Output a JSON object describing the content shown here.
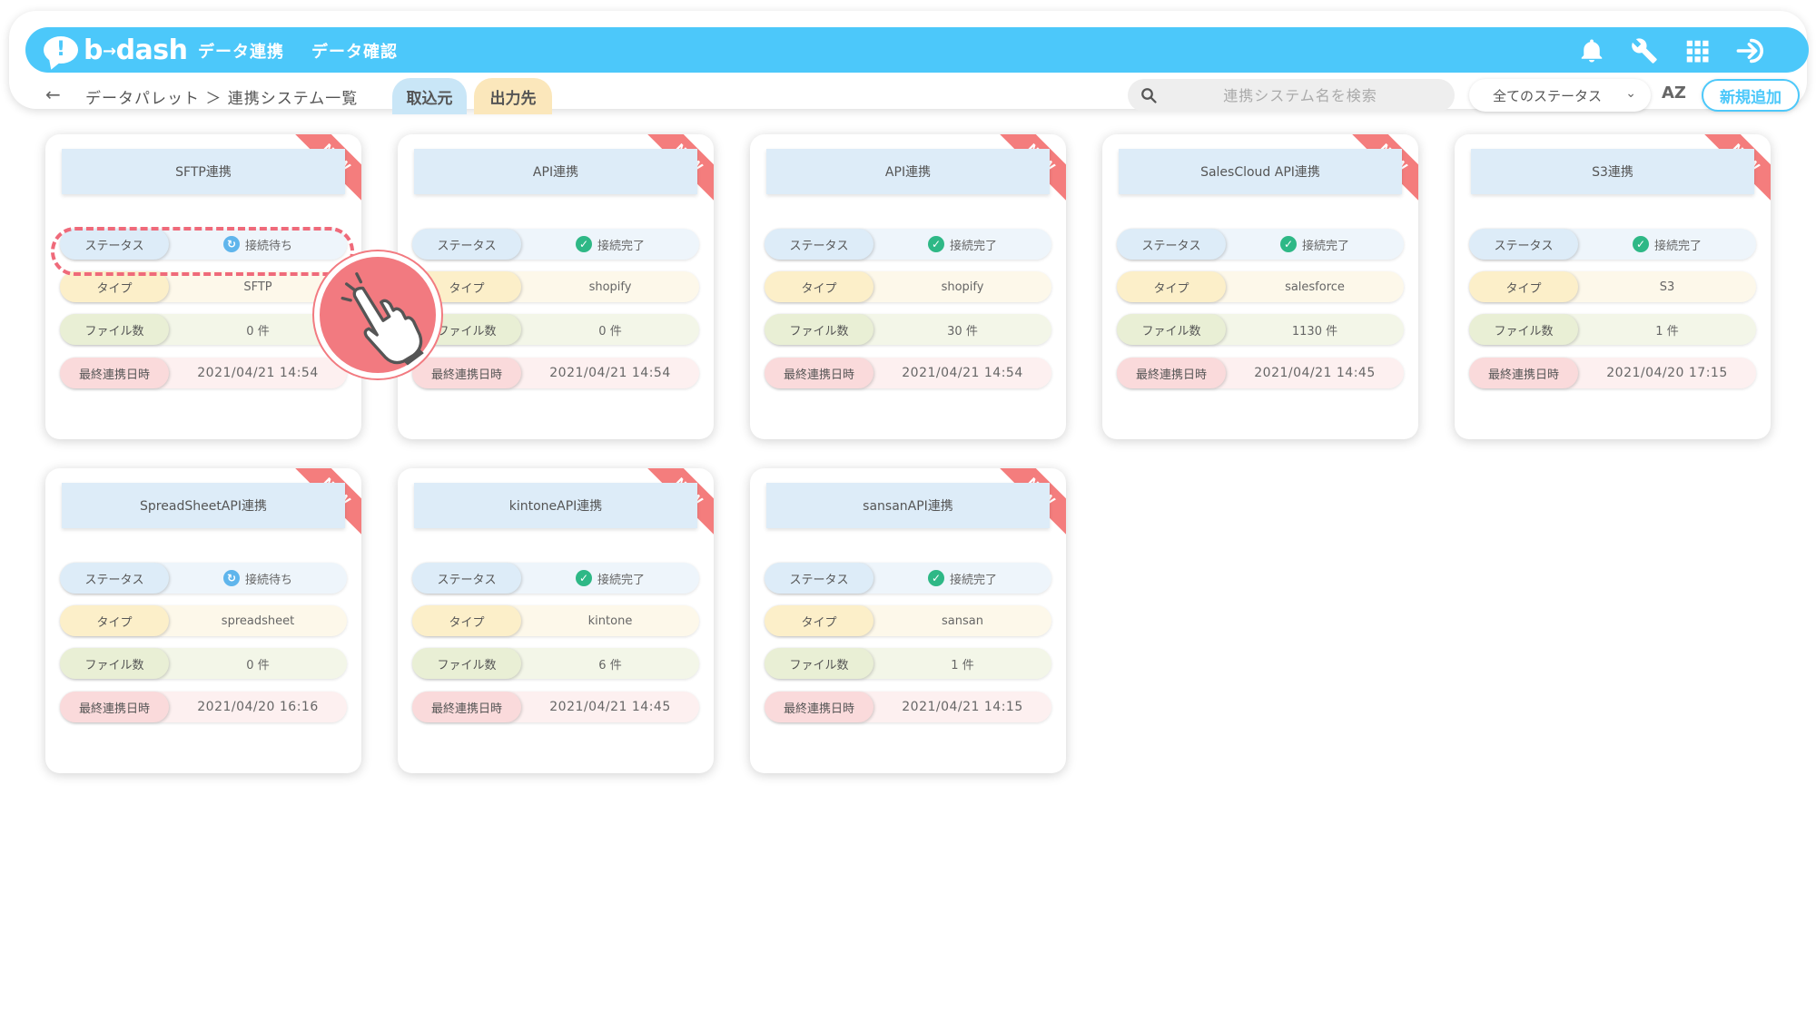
{
  "header": {
    "logo_text": "b",
    "logo_suffix": "dash",
    "nav": [
      "データ連携",
      "データ確認"
    ],
    "icons": [
      "bell-icon",
      "wrench-icon",
      "grid-icon",
      "login-icon"
    ]
  },
  "subbar": {
    "breadcrumb": "データパレット ＞ 連携システム一覧",
    "tabs": [
      "取込元",
      "出力先"
    ],
    "search_placeholder": "連携システム名を検索",
    "status_filter": "全てのステータス",
    "sort_label": "AZ",
    "new_button": "新規追加"
  },
  "labels": {
    "ribbon": "NEW",
    "status": "ステータス",
    "type": "タイプ",
    "files": "ファイル数",
    "last_sync": "最終連携日時"
  },
  "cards": [
    {
      "title": "SFTP連携",
      "status": "接続待ち",
      "status_kind": "waiting",
      "type": "SFTP",
      "files": "0 件",
      "last_sync": "2021/04/21 14:54"
    },
    {
      "title": "API連携",
      "status": "接続完了",
      "status_kind": "done",
      "type": "shopify",
      "files": "0 件",
      "last_sync": "2021/04/21 14:54"
    },
    {
      "title": "API連携",
      "status": "接続完了",
      "status_kind": "done",
      "type": "shopify",
      "files": "30 件",
      "last_sync": "2021/04/21 14:54"
    },
    {
      "title": "SalesCloud API連携",
      "status": "接続完了",
      "status_kind": "done",
      "type": "salesforce",
      "files": "1130 件",
      "last_sync": "2021/04/21 14:45"
    },
    {
      "title": "S3連携",
      "status": "接続完了",
      "status_kind": "done",
      "type": "S3",
      "files": "1 件",
      "last_sync": "2021/04/20 17:15"
    },
    {
      "title": "SpreadSheetAPI連携",
      "status": "接続待ち",
      "status_kind": "waiting",
      "type": "spreadsheet",
      "files": "0 件",
      "last_sync": "2021/04/20 16:16"
    },
    {
      "title": "kintoneAPI連携",
      "status": "接続完了",
      "status_kind": "done",
      "type": "kintone",
      "files": "6 件",
      "last_sync": "2021/04/21 14:45"
    },
    {
      "title": "sansanAPI連携",
      "status": "接続完了",
      "status_kind": "done",
      "type": "sansan",
      "files": "1 件",
      "last_sync": "2021/04/21 14:15"
    }
  ],
  "colors": {
    "brand": "#4cc8fa",
    "ribbon": "#f47d7d",
    "highlight": "#ef6a7a",
    "status_done": "#2eb886",
    "status_waiting": "#5fb5ec"
  }
}
